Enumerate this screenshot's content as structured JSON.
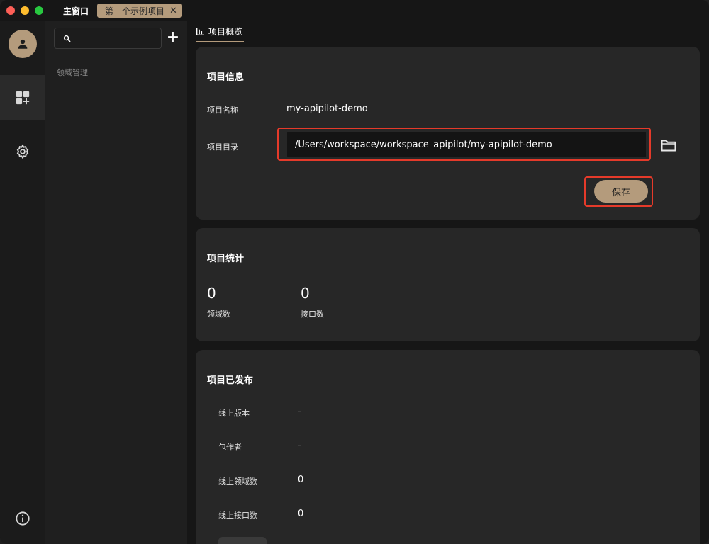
{
  "titlebar": {
    "main_tab": "主窗口",
    "project_tab": "第一个示例项目",
    "close_glyph": "✕"
  },
  "sidebar": {
    "search_placeholder": "",
    "add_glyph": "+",
    "section_label": "领域管理"
  },
  "main": {
    "tab_label": "项目概览"
  },
  "project_info": {
    "title": "项目信息",
    "name_label": "项目名称",
    "name_value": "my-apipilot-demo",
    "dir_label": "项目目录",
    "dir_value": "/Users/workspace/workspace_apipilot/my-apipilot-demo",
    "save_label": "保存"
  },
  "project_stats": {
    "title": "项目统计",
    "domain_count": "0",
    "domain_label": "领域数",
    "api_count": "0",
    "api_label": "接口数"
  },
  "project_publish": {
    "title": "项目已发布",
    "rows": [
      {
        "label": "线上版本",
        "value": "-"
      },
      {
        "label": "包作者",
        "value": "-"
      },
      {
        "label": "线上领域数",
        "value": "0"
      },
      {
        "label": "线上接口数",
        "value": "0"
      }
    ]
  },
  "colors": {
    "accent": "#b49b7c",
    "highlight_border": "#e53a2a",
    "card_bg": "#272727",
    "main_bg": "#161616"
  },
  "icons": [
    "user-icon",
    "dashboard-add-icon",
    "gear-icon",
    "info-icon",
    "search-icon",
    "bar-chart-icon",
    "folder-icon"
  ]
}
